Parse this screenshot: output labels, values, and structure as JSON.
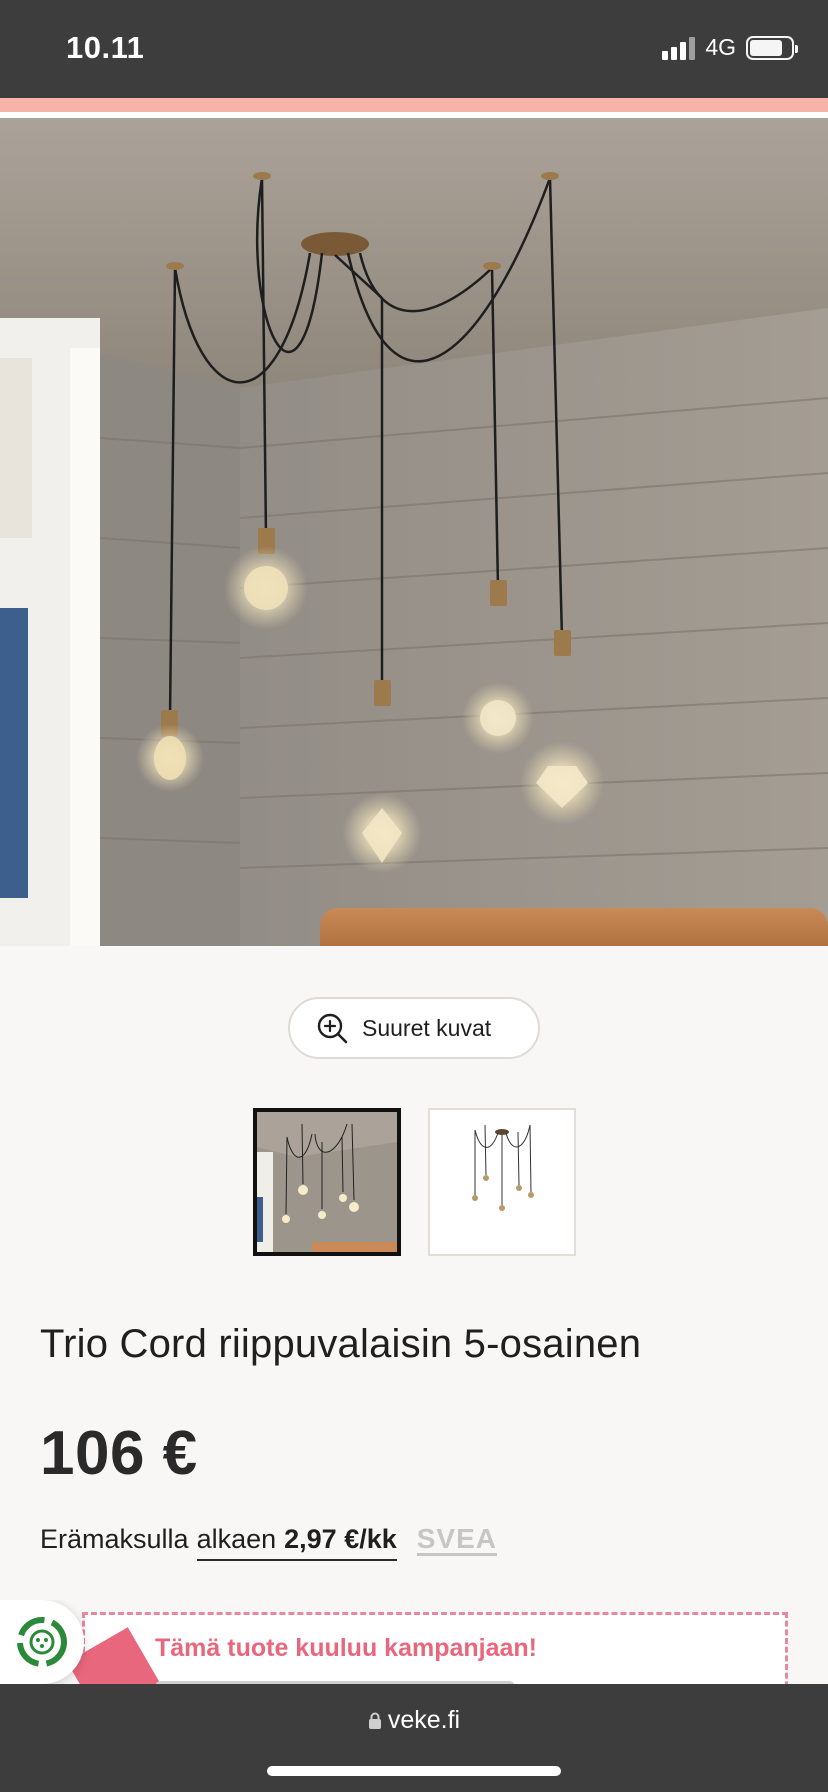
{
  "status_bar": {
    "time": "10.11",
    "network": "4G"
  },
  "zoom_button": {
    "label": "Suuret kuvat"
  },
  "product": {
    "title": "Trio Cord riippuvalaisin 5-osainen",
    "price": "106 €"
  },
  "installment": {
    "prefix": "Erämaksulla",
    "link_text": "alkaen",
    "amount": "2,97 €/kk",
    "provider": "SVEA"
  },
  "campaign": {
    "title": "Tämä tuote kuuluu kampanjaan!"
  },
  "browser": {
    "url": "veke.fi"
  },
  "colors": {
    "status_bar": "#3d3d3d",
    "promo_stripe": "#f6b4a8",
    "campaign_pink": "#e9677d",
    "background": "#f8f7f5"
  }
}
